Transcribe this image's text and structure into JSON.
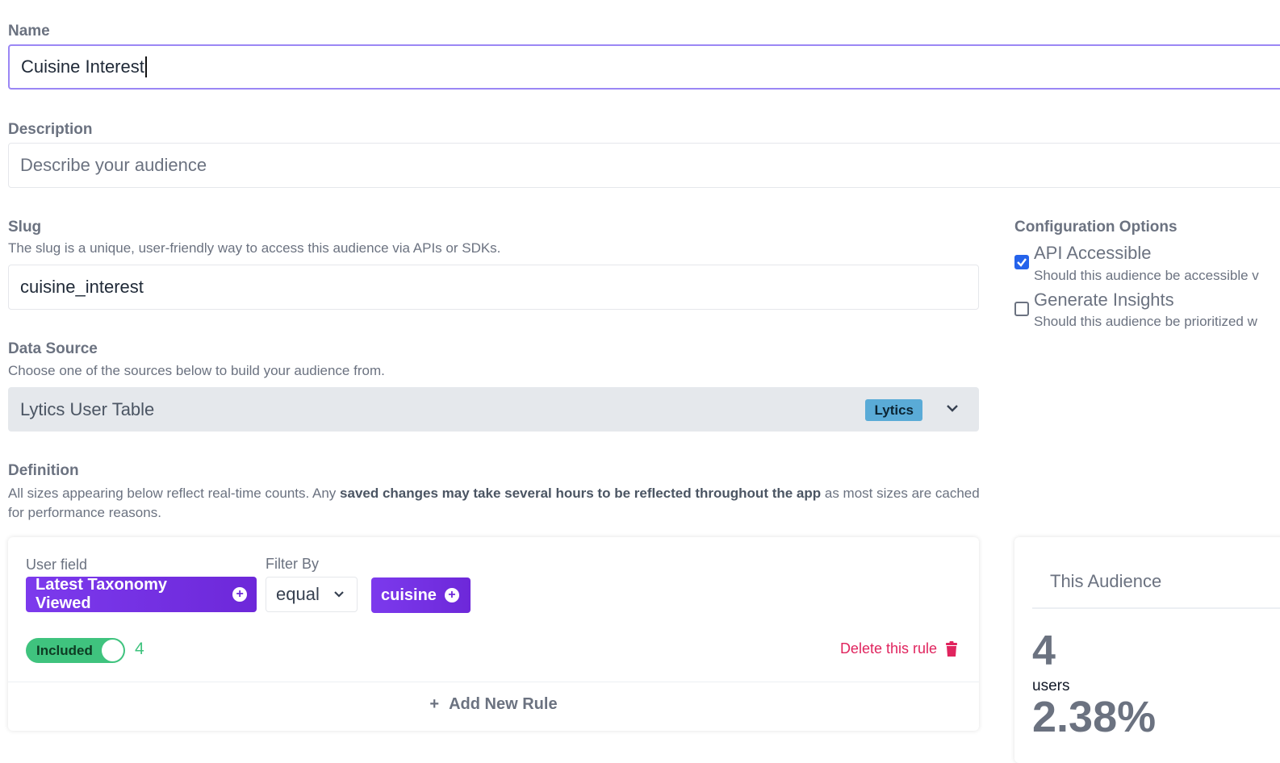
{
  "name": {
    "label": "Name",
    "value": "Cuisine Interest"
  },
  "description": {
    "label": "Description",
    "placeholder": "Describe your audience"
  },
  "slug": {
    "label": "Slug",
    "help": "The slug is a unique, user-friendly way to access this audience via APIs or SDKs.",
    "value": "cuisine_interest"
  },
  "data_source": {
    "label": "Data Source",
    "help": "Choose one of the sources below to build your audience from.",
    "selected": "Lytics User Table",
    "badge": "Lytics"
  },
  "config": {
    "title": "Configuration Options",
    "options": [
      {
        "label": "API Accessible",
        "help": "Should this audience be accessible v",
        "checked": true
      },
      {
        "label": "Generate Insights",
        "help": "Should this audience be prioritized w",
        "checked": false
      }
    ]
  },
  "definition": {
    "label": "Definition",
    "help_start": "All sizes appearing below reflect real-time counts. Any ",
    "help_bold": "saved changes may take several hours to be reflected throughout the app",
    "help_end": " as most sizes are cached for performance reasons."
  },
  "rule": {
    "user_field_label": "User field",
    "user_field_value": "Latest Taxonomy Viewed",
    "filter_label": "Filter By",
    "filter_value": "equal",
    "value_chip": "cuisine",
    "toggle_label": "Included",
    "count": "4",
    "delete_label": "Delete this rule"
  },
  "add_rule_label": "Add New Rule",
  "audience": {
    "title": "This Audience",
    "count": "4",
    "unit": "users",
    "percent": "2.38%"
  },
  "colors": {
    "accent_purple": "#6d28d9",
    "focus_border": "#9b87f5",
    "toggle_green": "#3fc37e",
    "delete_red": "#e0245e",
    "badge_blue": "#5aabd7"
  }
}
